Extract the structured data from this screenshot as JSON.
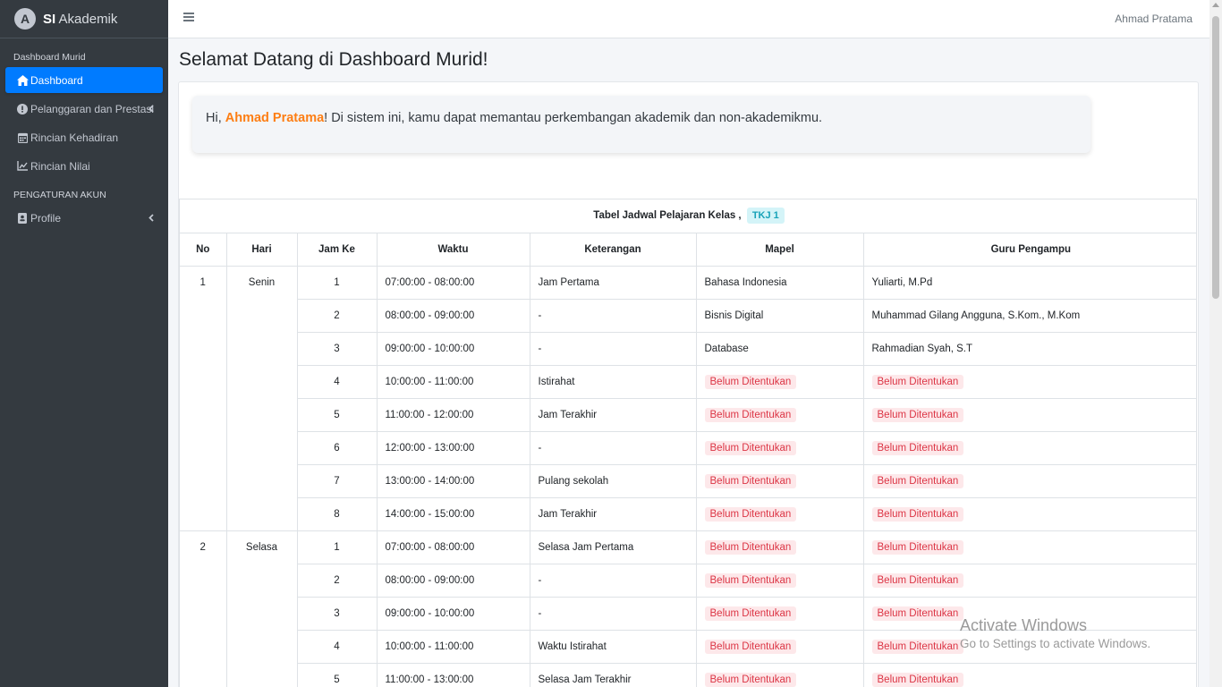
{
  "brand": {
    "prefix": "SI",
    "name": "Akademik",
    "logo_letter": "A"
  },
  "sidebar": {
    "header1": "Dashboard Murid",
    "items": [
      {
        "label": "Dashboard",
        "icon": "home-icon",
        "active": true
      },
      {
        "label": "Pelanggaran dan Prestasi",
        "icon": "exclamation-circle-icon"
      },
      {
        "label": "Rincian Kehadiran",
        "icon": "calendar-icon"
      },
      {
        "label": "Rincian Nilai",
        "icon": "chart-line-icon"
      }
    ],
    "header2": "PENGATURAN AKUN",
    "items2": [
      {
        "label": "Profile",
        "icon": "id-badge-icon"
      }
    ]
  },
  "topbar": {
    "user": "Ahmad Pratama"
  },
  "page": {
    "title": "Selamat Datang di Dashboard Murid!"
  },
  "welcome": {
    "prefix": "Hi, ",
    "name": "Ahmad Pratama",
    "suffix": "! Di sistem ini, kamu dapat memantau perkembangan akademik dan non-akademikmu."
  },
  "schedule": {
    "caption": "Tabel Jadwal Pelajaran Kelas ,",
    "class_badge": "TKJ 1",
    "headers": [
      "No",
      "Hari",
      "Jam Ke",
      "Waktu",
      "Keterangan",
      "Mapel",
      "Guru Pengampu"
    ],
    "days": [
      {
        "no": "1",
        "hari": "Senin",
        "rows": [
          {
            "jam": "1",
            "waktu": "07:00:00 - 08:00:00",
            "ket": "Jam Pertama",
            "mapel": "Bahasa Indonesia",
            "guru": "Yuliarti, M.Pd"
          },
          {
            "jam": "2",
            "waktu": "08:00:00 - 09:00:00",
            "ket": "-",
            "mapel": "Bisnis Digital",
            "guru": "Muhammad Gilang Angguna, S.Kom., M.Kom"
          },
          {
            "jam": "3",
            "waktu": "09:00:00 - 10:00:00",
            "ket": "-",
            "mapel": "Database",
            "guru": "Rahmadian Syah, S.T"
          },
          {
            "jam": "4",
            "waktu": "10:00:00 - 11:00:00",
            "ket": "Istirahat",
            "mapel": null,
            "guru": null
          },
          {
            "jam": "5",
            "waktu": "11:00:00 - 12:00:00",
            "ket": "Jam Terakhir",
            "mapel": null,
            "guru": null
          },
          {
            "jam": "6",
            "waktu": "12:00:00 - 13:00:00",
            "ket": "-",
            "mapel": null,
            "guru": null
          },
          {
            "jam": "7",
            "waktu": "13:00:00 - 14:00:00",
            "ket": "Pulang sekolah",
            "mapel": null,
            "guru": null
          },
          {
            "jam": "8",
            "waktu": "14:00:00 - 15:00:00",
            "ket": "Jam Terakhir",
            "mapel": null,
            "guru": null
          }
        ]
      },
      {
        "no": "2",
        "hari": "Selasa",
        "rows": [
          {
            "jam": "1",
            "waktu": "07:00:00 - 08:00:00",
            "ket": "Selasa Jam Pertama",
            "mapel": null,
            "guru": null
          },
          {
            "jam": "2",
            "waktu": "08:00:00 - 09:00:00",
            "ket": "-",
            "mapel": null,
            "guru": null
          },
          {
            "jam": "3",
            "waktu": "09:00:00 - 10:00:00",
            "ket": "-",
            "mapel": null,
            "guru": null
          },
          {
            "jam": "4",
            "waktu": "10:00:00 - 11:00:00",
            "ket": "Waktu Istirahat",
            "mapel": null,
            "guru": null
          },
          {
            "jam": "5",
            "waktu": "11:00:00 - 13:00:00",
            "ket": "Selasa Jam Terakhir",
            "mapel": null,
            "guru": null
          }
        ]
      }
    ],
    "unset_label": "Belum Ditentukan"
  },
  "watermark": {
    "line1": "Activate Windows",
    "line2": "Go to Settings to activate Windows."
  },
  "colors": {
    "sidebar_bg": "#343a40",
    "active": "#007bff",
    "highlight": "#fd7e14",
    "danger": "#dc3545",
    "info": "#17a2b8"
  }
}
